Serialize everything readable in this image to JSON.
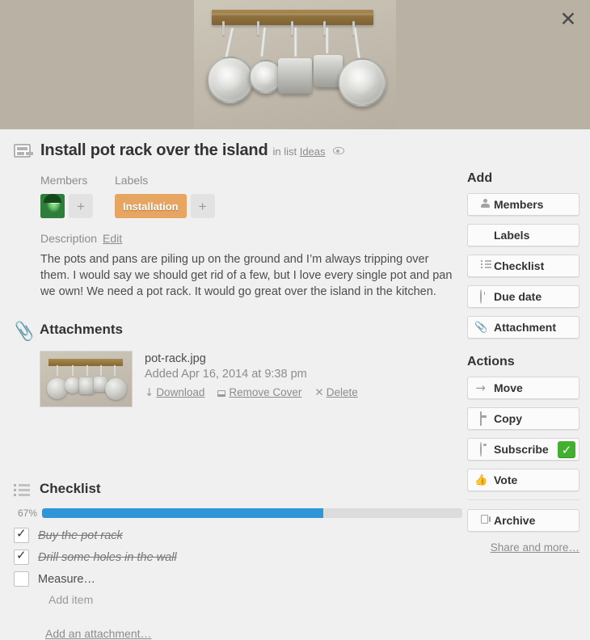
{
  "cover": {
    "close_label": "✕",
    "alt": "pot rack with hanging pans"
  },
  "card": {
    "title": "Install pot rack over the island",
    "in_list_prefix": "in list",
    "list_name": "Ideas",
    "watch_icon": "eye-icon"
  },
  "members": {
    "heading": "Members",
    "add_label": "+"
  },
  "labels": {
    "heading": "Labels",
    "items": [
      {
        "name": "Installation",
        "color": "#e6a561"
      }
    ],
    "add_label": "+"
  },
  "description": {
    "heading": "Description",
    "edit_label": "Edit",
    "text": "The pots and pans are piling up on the ground and I’m always tripping over them. I would say we should get rid of a few, but I love every single pot and pan we own! We need a pot rack. It would go great over the island in the kitchen."
  },
  "attachments": {
    "heading": "Attachments",
    "items": [
      {
        "filename": "pot-rack.jpg",
        "added": "Added Apr 16, 2014 at 9:38 pm",
        "download_label": "Download",
        "remove_cover_label": "Remove Cover",
        "delete_label": "Delete"
      }
    ],
    "add_label": "Add an attachment…"
  },
  "checklist": {
    "heading": "Checklist",
    "percent_label": "67%",
    "percent_value": 67,
    "items": [
      {
        "text": "Buy the pot rack",
        "checked": true
      },
      {
        "text": "Drill some holes in the wall",
        "checked": true
      },
      {
        "text": "Measure…",
        "checked": false
      }
    ],
    "add_item_label": "Add item"
  },
  "sidebar": {
    "add_heading": "Add",
    "add_buttons": [
      {
        "label": "Members",
        "icon": "person-icon"
      },
      {
        "label": "Labels",
        "icon": "tag-icon"
      },
      {
        "label": "Checklist",
        "icon": "list-icon"
      },
      {
        "label": "Due date",
        "icon": "clock-icon"
      },
      {
        "label": "Attachment",
        "icon": "paperclip-icon"
      }
    ],
    "actions_heading": "Actions",
    "action_buttons": [
      {
        "label": "Move",
        "icon": "arrow-right-icon"
      },
      {
        "label": "Copy",
        "icon": "card-icon"
      },
      {
        "label": "Subscribe",
        "icon": "eye-icon",
        "badge": "✓",
        "badge_color": "#43af2e"
      },
      {
        "label": "Vote",
        "icon": "thumbs-up-icon"
      },
      {
        "label": "Archive",
        "icon": "archive-icon"
      }
    ],
    "share_label": "Share and more…"
  }
}
